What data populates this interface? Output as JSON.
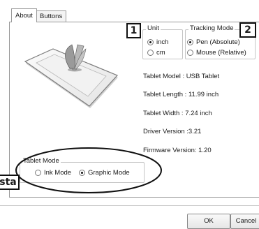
{
  "tabs": [
    {
      "label": "About",
      "active": true
    },
    {
      "label": "Buttons",
      "active": false
    }
  ],
  "unit": {
    "legend": "Unit",
    "options": [
      {
        "label": "inch",
        "selected": true
      },
      {
        "label": "cm",
        "selected": false
      }
    ]
  },
  "tracking_mode": {
    "legend": "Tracking Mode",
    "options": [
      {
        "label": "Pen (Absolute)",
        "selected": true
      },
      {
        "label": "Mouse (Relative)",
        "selected": false
      }
    ]
  },
  "tablet_info": {
    "model": "Tablet Model : USB Tablet",
    "length": "Tablet Length : 11.99 inch",
    "width": "Tablet Width : 7.24 inch",
    "driver_version": "Driver Version :3.21",
    "firmware_version": "Firmware Version: 1.20"
  },
  "tablet_mode": {
    "legend": "Tablet Mode",
    "options": [
      {
        "label": "Ink Mode",
        "selected": false
      },
      {
        "label": "Graphic Mode",
        "selected": true
      }
    ]
  },
  "callouts": {
    "one": "1",
    "two": "2",
    "left": "sta"
  },
  "buttons": {
    "ok": "OK",
    "cancel": "Cancel"
  }
}
